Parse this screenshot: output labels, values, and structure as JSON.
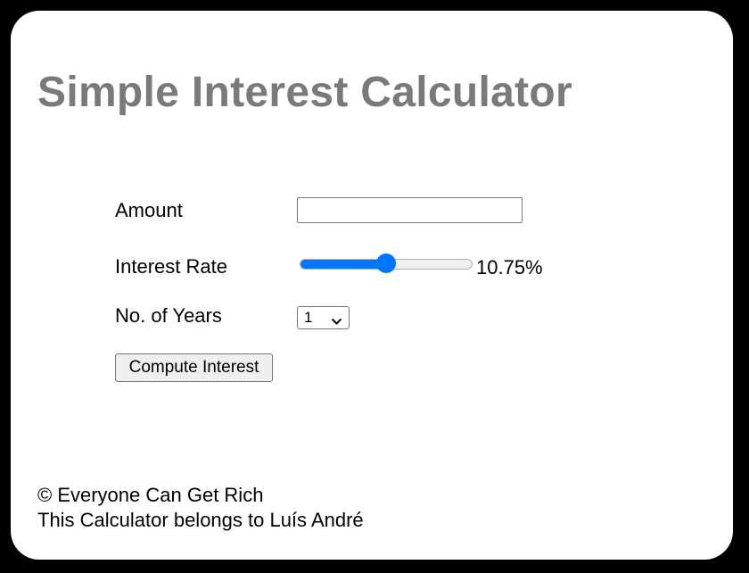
{
  "header": {
    "title": "Simple Interest Calculator"
  },
  "form": {
    "amount": {
      "label": "Amount",
      "value": ""
    },
    "interest_rate": {
      "label": "Interest Rate",
      "value_text": "10.75%",
      "level_fraction": 0.5
    },
    "years": {
      "label": "No. of Years",
      "selected": "1"
    },
    "compute_button": {
      "label": "Compute Interest"
    }
  },
  "footer": {
    "copyright": "© Everyone Can Get Rich",
    "owner": "This Calculator belongs to Luís André"
  },
  "colors": {
    "title": "#7a7a7a",
    "accent": "#0075ff",
    "background": "#000000",
    "card": "#ffffff"
  }
}
